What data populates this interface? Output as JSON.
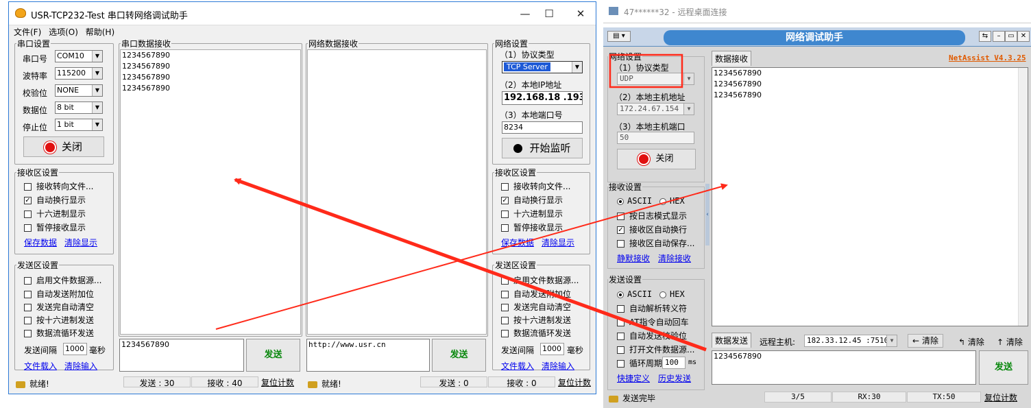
{
  "left": {
    "title": "USR-TCP232-Test 串口转网络调试助手",
    "window_buttons": {
      "minimize": "—",
      "maximize": "☐",
      "close": "✕"
    },
    "menu": [
      "文件(F)",
      "选项(O)",
      "帮助(H)"
    ],
    "serial_settings": {
      "legend": "串口设置",
      "port_label": "串口号",
      "port_value": "COM10",
      "baud_label": "波特率",
      "baud_value": "115200",
      "parity_label": "校验位",
      "parity_value": "NONE",
      "databits_label": "数据位",
      "databits_value": "8 bit",
      "stopbits_label": "停止位",
      "stopbits_value": "1 bit",
      "close_button": "关闭"
    },
    "recv_settings": {
      "legend": "接收区设置",
      "options": [
        {
          "label": "接收转向文件...",
          "checked": false
        },
        {
          "label": "自动换行显示",
          "checked": true
        },
        {
          "label": "十六进制显示",
          "checked": false
        },
        {
          "label": "暂停接收显示",
          "checked": false
        }
      ],
      "save_link": "保存数据",
      "clear_link": "清除显示"
    },
    "send_settings": {
      "legend": "发送区设置",
      "options": [
        {
          "label": "启用文件数据源...",
          "checked": false
        },
        {
          "label": "自动发送附加位",
          "checked": false
        },
        {
          "label": "发送完自动清空",
          "checked": false
        },
        {
          "label": "按十六进制发送",
          "checked": false
        },
        {
          "label": "数据流循环发送",
          "checked": false
        }
      ],
      "interval_label": "发送间隔",
      "interval_value": "1000",
      "interval_unit": "毫秒",
      "load_link": "文件载入",
      "clear_link": "清除输入"
    },
    "serial_recv": {
      "legend": "串口数据接收",
      "lines": [
        "1234567890",
        "1234567890",
        "1234567890",
        "1234567890"
      ]
    },
    "net_recv": {
      "legend": "网络数据接收",
      "lines": []
    },
    "serial_send_text": "1234567890",
    "net_send_text": "http://www.usr.cn",
    "send_button": "发送",
    "net_settings": {
      "legend": "网络设置",
      "protocol_label": "（1）协议类型",
      "protocol_value": "TCP Server",
      "ip_label": "（2）本地IP地址",
      "ip_value": "192.168.18 .193",
      "port_label": "（3）本地端口号",
      "port_value": "8234",
      "listen_button": "开始监听"
    },
    "recv_settings_right": {
      "legend": "接收区设置",
      "options": [
        {
          "label": "接收转向文件...",
          "checked": false
        },
        {
          "label": "自动换行显示",
          "checked": true
        },
        {
          "label": "十六进制显示",
          "checked": false
        },
        {
          "label": "暂停接收显示",
          "checked": false
        }
      ],
      "save_link": "保存数据",
      "clear_link": "清除显示"
    },
    "send_settings_right": {
      "legend": "发送区设置",
      "options": [
        {
          "label": "启用文件数据源...",
          "checked": false
        },
        {
          "label": "自动发送附加位",
          "checked": false
        },
        {
          "label": "发送完自动清空",
          "checked": false
        },
        {
          "label": "按十六进制发送",
          "checked": false
        },
        {
          "label": "数据流循环发送",
          "checked": false
        }
      ],
      "interval_label": "发送间隔",
      "interval_value": "1000",
      "interval_unit": "毫秒",
      "load_link": "文件载入",
      "clear_link": "清除输入"
    },
    "status": {
      "ready1": "就绪!",
      "sent1": "发送 : 30",
      "recv1": "接收 : 40",
      "reset1": "复位计数",
      "ready2": "就绪!",
      "sent2": "发送 : 0",
      "recv2": "接收 : 0",
      "reset2": "复位计数"
    }
  },
  "right": {
    "rd_title": "47******32 - 远程桌面连接",
    "app_title": "网络调试助手",
    "brand": "NetAssist V4.3.25",
    "net_settings": {
      "legend": "网络设置",
      "protocol_label": "（1）协议类型",
      "protocol_value": "UDP",
      "host_label": "（2）本地主机地址",
      "host_value": "172.24.67.154",
      "port_label": "（3）本地主机端口",
      "port_value": "50",
      "close_button": "关闭"
    },
    "recv_settings": {
      "legend": "接收设置",
      "ascii": "ASCII",
      "hex": "HEX",
      "options": [
        {
          "label": "按日志模式显示",
          "checked": false
        },
        {
          "label": "接收区自动换行",
          "checked": true
        },
        {
          "label": "接收区自动保存...",
          "checked": false
        }
      ],
      "save_link": "静默接收",
      "clear_link": "清除接收"
    },
    "send_settings": {
      "legend": "发送设置",
      "ascii": "ASCII",
      "hex": "HEX",
      "options": [
        {
          "label": "自动解析转义符",
          "checked": false
        },
        {
          "label": "AT指令自动回车",
          "checked": false
        },
        {
          "label": "自动发送校验位",
          "checked": false
        },
        {
          "label": "打开文件数据源...",
          "checked": false
        }
      ],
      "cycle_label": "循环周期",
      "cycle_value": "100",
      "cycle_unit": "ms",
      "shortcut_link": "快捷定义",
      "history_link": "历史发送"
    },
    "recv_tab": "数据接收",
    "recv_lines": [
      "1234567890",
      "1234567890",
      "1234567890"
    ],
    "send_tab": "数据发送",
    "remote_label": "远程主机:",
    "remote_value": "182.33.12.45 :7510",
    "clear_btn": "清除",
    "clear_btn2": "清除",
    "clear_btn3": "清除",
    "send_text": "1234567890",
    "send_button": "发送",
    "status": {
      "msg": "发送完毕",
      "count": "3/5",
      "rx": "RX:30",
      "tx": "TX:50",
      "reset": "复位计数"
    }
  },
  "annotation_color": "#ff2a1a"
}
